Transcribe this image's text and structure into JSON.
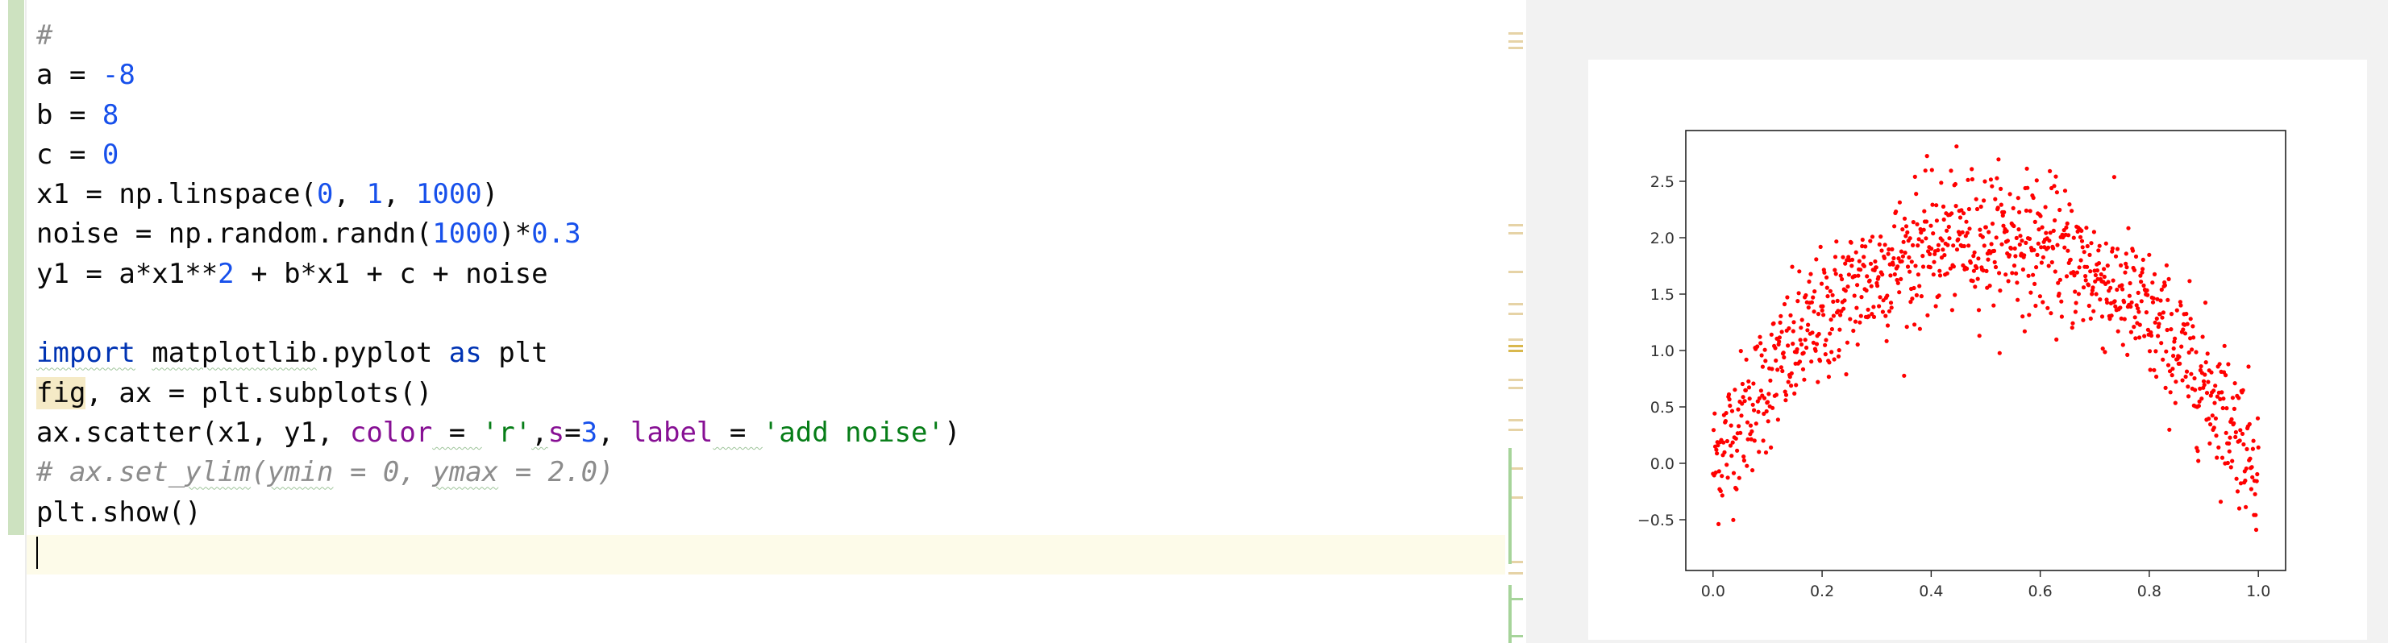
{
  "editor": {
    "lines": [
      [
        {
          "t": "#",
          "c": "comment"
        }
      ],
      [
        {
          "t": "a = ",
          "c": ""
        },
        {
          "t": "-8",
          "c": "num"
        }
      ],
      [
        {
          "t": "b = ",
          "c": ""
        },
        {
          "t": "8",
          "c": "num"
        }
      ],
      [
        {
          "t": "c = ",
          "c": ""
        },
        {
          "t": "0",
          "c": "num"
        }
      ],
      [
        {
          "t": "x1 = np.linspace(",
          "c": ""
        },
        {
          "t": "0",
          "c": "num"
        },
        {
          "t": ", ",
          "c": ""
        },
        {
          "t": "1",
          "c": "num"
        },
        {
          "t": ", ",
          "c": ""
        },
        {
          "t": "1000",
          "c": "num"
        },
        {
          "t": ")",
          "c": ""
        }
      ],
      [
        {
          "t": "noise = np.random.randn(",
          "c": ""
        },
        {
          "t": "1000",
          "c": "num"
        },
        {
          "t": ")*",
          "c": ""
        },
        {
          "t": "0.3",
          "c": "num"
        }
      ],
      [
        {
          "t": "y1 = a*x1**",
          "c": ""
        },
        {
          "t": "2",
          "c": "num"
        },
        {
          "t": " + b*x1 + c + noise",
          "c": ""
        }
      ],
      [],
      [
        {
          "t": "import",
          "c": "kw typo"
        },
        {
          "t": " ",
          "c": ""
        },
        {
          "t": "matplotlib",
          "c": "typo"
        },
        {
          "t": ".pyplot ",
          "c": ""
        },
        {
          "t": "as",
          "c": "kw"
        },
        {
          "t": " plt",
          "c": ""
        }
      ],
      [
        {
          "t": "fig",
          "c": "hl"
        },
        {
          "t": ", ax = plt.subplots()",
          "c": ""
        }
      ],
      [
        {
          "t": "ax.scatter(x1, y1, ",
          "c": ""
        },
        {
          "t": "color",
          "c": "param"
        },
        {
          "t": " = ",
          "c": "typo"
        },
        {
          "t": "'r'",
          "c": "str"
        },
        {
          "t": ",",
          "c": "typo"
        },
        {
          "t": "s",
          "c": "param"
        },
        {
          "t": "=",
          "c": ""
        },
        {
          "t": "3",
          "c": "num"
        },
        {
          "t": ", ",
          "c": ""
        },
        {
          "t": "label",
          "c": "param"
        },
        {
          "t": " = ",
          "c": "typo"
        },
        {
          "t": "'add noise'",
          "c": "str"
        },
        {
          "t": ")",
          "c": ""
        }
      ],
      [
        {
          "t": "# ax.set_",
          "c": "comment"
        },
        {
          "t": "ylim",
          "c": "comment typo"
        },
        {
          "t": "(",
          "c": "comment"
        },
        {
          "t": "ymin",
          "c": "comment typo"
        },
        {
          "t": " = 0, ",
          "c": "comment"
        },
        {
          "t": "ymax",
          "c": "comment typo"
        },
        {
          "t": " = 2.0)",
          "c": "comment"
        }
      ],
      [
        {
          "t": "plt.show()",
          "c": ""
        }
      ],
      []
    ]
  },
  "plot": {
    "xticks": [
      "0.0",
      "0.2",
      "0.4",
      "0.6",
      "0.8",
      "1.0"
    ],
    "yticks": [
      "−0.5",
      "0.0",
      "0.5",
      "1.0",
      "1.5",
      "2.0",
      "2.5"
    ]
  },
  "chart_data": {
    "type": "scatter",
    "generator": {
      "a": -8,
      "b": 8,
      "c": 0,
      "n": 1000,
      "noise_std": 0.3,
      "x_range": [
        0,
        1
      ]
    },
    "xlim": [
      -0.05,
      1.05
    ],
    "ylim": [
      -0.95,
      2.95
    ],
    "xticks": [
      0.0,
      0.2,
      0.4,
      0.6,
      0.8,
      1.0
    ],
    "yticks": [
      -0.5,
      0.0,
      0.5,
      1.0,
      1.5,
      2.0,
      2.5
    ],
    "marker_color": "#ff0000",
    "grid": false
  }
}
